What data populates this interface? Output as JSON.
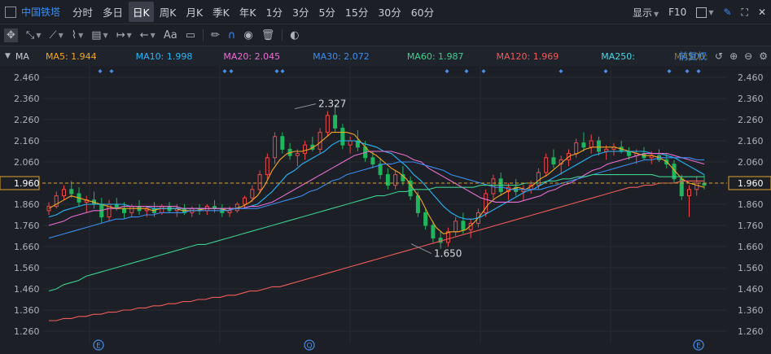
{
  "header": {
    "stock_name": "中国铁塔",
    "timeframes": [
      "分时",
      "多日",
      "日K",
      "周K",
      "月K",
      "季K",
      "年K",
      "1分",
      "3分",
      "5分",
      "15分",
      "30分",
      "60分"
    ],
    "active_timeframe": "日K",
    "display_label": "显示",
    "f10_label": "F10"
  },
  "toolbar": {
    "aa_label": "Aa",
    "icons": [
      "move-icon",
      "crosshair-icon",
      "line-tool-icon",
      "wave-tool-icon",
      "fib-tool-icon",
      "measure-tool-icon",
      "arrow-tool-icon",
      "text-tool-icon",
      "comment-icon",
      "pen-icon",
      "magnet-icon",
      "eye-icon",
      "trash-icon",
      "toggle-icon"
    ]
  },
  "ma_bar": {
    "label": "MA",
    "items": [
      {
        "label": "MA5: 1.944",
        "color": "#f5a623"
      },
      {
        "label": "MA10: 1.998",
        "color": "#29b6f6"
      },
      {
        "label": "MA20: 2.045",
        "color": "#e96fd4"
      },
      {
        "label": "MA30: 2.072",
        "color": "#3b8df0"
      },
      {
        "label": "MA60: 1.987",
        "color": "#3ccf8e"
      },
      {
        "label": "MA120: 1.969",
        "color": "#f05b5b"
      },
      {
        "label": "MA250:",
        "color": "#4ed6e6"
      },
      {
        "label": "MA500:",
        "color": "#8a7a3a"
      }
    ],
    "adjust_label": "前复权"
  },
  "chart_data": {
    "type": "candlestick",
    "ylim": [
      1.22,
      2.49
    ],
    "yticks": [
      "2.460",
      "2.360",
      "2.260",
      "2.160",
      "2.060",
      "1.960",
      "1.860",
      "1.760",
      "1.660",
      "1.560",
      "1.460",
      "1.360",
      "1.260"
    ],
    "current_price": "1.960",
    "annotations": [
      {
        "label": "2.327",
        "value": 2.327
      },
      {
        "label": "1.650",
        "value": 1.65
      }
    ],
    "event_markers": [
      "E",
      "Q",
      "E"
    ],
    "ohlc": [
      [
        1.83,
        1.87,
        1.81,
        1.85
      ],
      [
        1.85,
        1.92,
        1.84,
        1.9
      ],
      [
        1.9,
        1.95,
        1.88,
        1.93
      ],
      [
        1.93,
        1.97,
        1.89,
        1.91
      ],
      [
        1.91,
        1.94,
        1.85,
        1.87
      ],
      [
        1.87,
        1.9,
        1.82,
        1.88
      ],
      [
        1.88,
        1.92,
        1.84,
        1.86
      ],
      [
        1.86,
        1.89,
        1.77,
        1.8
      ],
      [
        1.8,
        1.88,
        1.78,
        1.86
      ],
      [
        1.86,
        1.89,
        1.83,
        1.84
      ],
      [
        1.84,
        1.87,
        1.79,
        1.82
      ],
      [
        1.82,
        1.86,
        1.8,
        1.85
      ],
      [
        1.85,
        1.88,
        1.81,
        1.83
      ],
      [
        1.83,
        1.85,
        1.8,
        1.84
      ],
      [
        1.84,
        1.87,
        1.8,
        1.82
      ],
      [
        1.82,
        1.86,
        1.81,
        1.85
      ],
      [
        1.85,
        1.87,
        1.82,
        1.83
      ],
      [
        1.83,
        1.86,
        1.8,
        1.84
      ],
      [
        1.84,
        1.86,
        1.81,
        1.82
      ],
      [
        1.82,
        1.85,
        1.8,
        1.84
      ],
      [
        1.84,
        1.86,
        1.81,
        1.83
      ],
      [
        1.83,
        1.86,
        1.81,
        1.85
      ],
      [
        1.85,
        1.88,
        1.82,
        1.84
      ],
      [
        1.84,
        1.86,
        1.8,
        1.82
      ],
      [
        1.82,
        1.85,
        1.8,
        1.83
      ],
      [
        1.83,
        1.87,
        1.82,
        1.86
      ],
      [
        1.86,
        1.9,
        1.84,
        1.89
      ],
      [
        1.89,
        1.95,
        1.87,
        1.93
      ],
      [
        1.93,
        2.02,
        1.91,
        2.0
      ],
      [
        2.0,
        2.1,
        1.98,
        2.08
      ],
      [
        2.08,
        2.2,
        2.05,
        2.18
      ],
      [
        2.18,
        2.2,
        2.1,
        2.12
      ],
      [
        2.12,
        2.15,
        2.07,
        2.09
      ],
      [
        2.09,
        2.12,
        2.04,
        2.1
      ],
      [
        2.1,
        2.16,
        2.07,
        2.14
      ],
      [
        2.14,
        2.18,
        2.11,
        2.12
      ],
      [
        2.12,
        2.22,
        2.1,
        2.2
      ],
      [
        2.2,
        2.3,
        2.18,
        2.28
      ],
      [
        2.28,
        2.33,
        2.2,
        2.22
      ],
      [
        2.22,
        2.24,
        2.12,
        2.14
      ],
      [
        2.14,
        2.18,
        2.1,
        2.16
      ],
      [
        2.16,
        2.21,
        2.11,
        2.13
      ],
      [
        2.13,
        2.16,
        2.06,
        2.08
      ],
      [
        2.08,
        2.11,
        2.03,
        2.05
      ],
      [
        2.05,
        2.08,
        1.98,
        2.0
      ],
      [
        2.0,
        2.03,
        1.93,
        1.95
      ],
      [
        1.95,
        2.02,
        1.93,
        2.0
      ],
      [
        2.0,
        2.04,
        1.95,
        1.97
      ],
      [
        1.97,
        1.99,
        1.88,
        1.9
      ],
      [
        1.9,
        1.92,
        1.8,
        1.82
      ],
      [
        1.82,
        1.84,
        1.74,
        1.76
      ],
      [
        1.76,
        1.78,
        1.68,
        1.7
      ],
      [
        1.7,
        1.73,
        1.65,
        1.68
      ],
      [
        1.68,
        1.75,
        1.66,
        1.73
      ],
      [
        1.73,
        1.8,
        1.71,
        1.78
      ],
      [
        1.78,
        1.82,
        1.72,
        1.74
      ],
      [
        1.74,
        1.79,
        1.7,
        1.77
      ],
      [
        1.77,
        1.84,
        1.75,
        1.82
      ],
      [
        1.82,
        1.93,
        1.8,
        1.91
      ],
      [
        1.91,
        2.0,
        1.88,
        1.98
      ],
      [
        1.98,
        2.01,
        1.9,
        1.92
      ],
      [
        1.92,
        1.96,
        1.88,
        1.94
      ],
      [
        1.94,
        1.98,
        1.9,
        1.92
      ],
      [
        1.92,
        1.95,
        1.88,
        1.93
      ],
      [
        1.93,
        1.97,
        1.91,
        1.95
      ],
      [
        1.95,
        2.03,
        1.93,
        2.01
      ],
      [
        2.01,
        2.1,
        1.99,
        2.08
      ],
      [
        2.08,
        2.12,
        2.03,
        2.05
      ],
      [
        2.05,
        2.09,
        2.0,
        2.07
      ],
      [
        2.07,
        2.12,
        2.04,
        2.1
      ],
      [
        2.1,
        2.17,
        2.08,
        2.15
      ],
      [
        2.15,
        2.2,
        2.11,
        2.13
      ],
      [
        2.13,
        2.19,
        2.1,
        2.16
      ],
      [
        2.16,
        2.18,
        2.09,
        2.11
      ],
      [
        2.11,
        2.14,
        2.07,
        2.12
      ],
      [
        2.12,
        2.15,
        2.09,
        2.13
      ],
      [
        2.13,
        2.16,
        2.1,
        2.11
      ],
      [
        2.11,
        2.13,
        2.07,
        2.09
      ],
      [
        2.09,
        2.12,
        2.05,
        2.1
      ],
      [
        2.1,
        2.13,
        2.07,
        2.08
      ],
      [
        2.08,
        2.11,
        2.05,
        2.09
      ],
      [
        2.09,
        2.12,
        2.06,
        2.07
      ],
      [
        2.07,
        2.1,
        2.03,
        2.05
      ],
      [
        2.05,
        2.07,
        1.96,
        1.98
      ],
      [
        1.98,
        2.0,
        1.88,
        1.9
      ],
      [
        1.9,
        1.95,
        1.8,
        1.93
      ],
      [
        1.93,
        1.99,
        1.9,
        1.96
      ],
      [
        1.96,
        2.0,
        1.93,
        1.95
      ]
    ],
    "ma": {
      "MA5": [
        1.84,
        1.86,
        1.88,
        1.9,
        1.89,
        1.88,
        1.87,
        1.86,
        1.85,
        1.84,
        1.84,
        1.84,
        1.84,
        1.84,
        1.83,
        1.84,
        1.84,
        1.84,
        1.83,
        1.83,
        1.83,
        1.84,
        1.84,
        1.84,
        1.83,
        1.84,
        1.85,
        1.87,
        1.9,
        1.95,
        2.02,
        2.07,
        2.1,
        2.11,
        2.11,
        2.12,
        2.14,
        2.17,
        2.2,
        2.2,
        2.2,
        2.19,
        2.15,
        2.11,
        2.09,
        2.06,
        2.03,
        2.01,
        1.98,
        1.93,
        1.88,
        1.81,
        1.75,
        1.72,
        1.73,
        1.73,
        1.74,
        1.77,
        1.81,
        1.86,
        1.89,
        1.91,
        1.93,
        1.94,
        1.93,
        1.95,
        1.98,
        2.0,
        2.03,
        2.06,
        2.09,
        2.1,
        2.12,
        2.13,
        2.13,
        2.13,
        2.13,
        2.12,
        2.11,
        2.1,
        2.09,
        2.09,
        2.08,
        2.06,
        2.02,
        1.98,
        1.96,
        1.95,
        1.94
      ],
      "MA10": [
        1.8,
        1.81,
        1.83,
        1.84,
        1.85,
        1.86,
        1.86,
        1.86,
        1.86,
        1.86,
        1.86,
        1.85,
        1.85,
        1.85,
        1.84,
        1.84,
        1.84,
        1.84,
        1.84,
        1.84,
        1.84,
        1.84,
        1.84,
        1.84,
        1.84,
        1.84,
        1.84,
        1.85,
        1.86,
        1.89,
        1.92,
        1.96,
        2.0,
        2.02,
        2.05,
        2.07,
        2.09,
        2.11,
        2.14,
        2.16,
        2.16,
        2.16,
        2.15,
        2.14,
        2.13,
        2.11,
        2.1,
        2.07,
        2.04,
        2.0,
        1.97,
        1.93,
        1.89,
        1.85,
        1.82,
        1.8,
        1.79,
        1.79,
        1.8,
        1.82,
        1.84,
        1.86,
        1.88,
        1.9,
        1.92,
        1.93,
        1.95,
        1.97,
        1.99,
        2.01,
        2.03,
        2.05,
        2.07,
        2.09,
        2.1,
        2.11,
        2.11,
        2.11,
        2.11,
        2.11,
        2.11,
        2.1,
        2.1,
        2.09,
        2.08,
        2.06,
        2.04,
        2.02,
        2.0
      ],
      "MA20": [
        1.76,
        1.77,
        1.78,
        1.8,
        1.81,
        1.82,
        1.83,
        1.83,
        1.84,
        1.84,
        1.85,
        1.85,
        1.85,
        1.85,
        1.85,
        1.85,
        1.85,
        1.85,
        1.84,
        1.84,
        1.84,
        1.84,
        1.84,
        1.84,
        1.84,
        1.84,
        1.84,
        1.85,
        1.85,
        1.86,
        1.87,
        1.89,
        1.91,
        1.93,
        1.95,
        1.97,
        1.99,
        2.01,
        2.03,
        2.05,
        2.07,
        2.09,
        2.1,
        2.11,
        2.11,
        2.11,
        2.11,
        2.1,
        2.09,
        2.07,
        2.06,
        2.03,
        2.01,
        1.99,
        1.97,
        1.95,
        1.93,
        1.91,
        1.89,
        1.88,
        1.87,
        1.87,
        1.87,
        1.87,
        1.88,
        1.89,
        1.9,
        1.92,
        1.93,
        1.95,
        1.96,
        1.98,
        2.0,
        2.02,
        2.03,
        2.05,
        2.06,
        2.07,
        2.08,
        2.09,
        2.1,
        2.1,
        2.1,
        2.1,
        2.09,
        2.08,
        2.07,
        2.06,
        2.05
      ],
      "MA30": [
        1.7,
        1.71,
        1.72,
        1.73,
        1.74,
        1.75,
        1.76,
        1.77,
        1.78,
        1.79,
        1.79,
        1.8,
        1.8,
        1.81,
        1.81,
        1.82,
        1.82,
        1.82,
        1.82,
        1.83,
        1.83,
        1.83,
        1.83,
        1.83,
        1.83,
        1.84,
        1.84,
        1.84,
        1.84,
        1.85,
        1.86,
        1.87,
        1.88,
        1.89,
        1.9,
        1.92,
        1.93,
        1.95,
        1.97,
        1.98,
        2.0,
        2.01,
        2.02,
        2.03,
        2.04,
        2.05,
        2.05,
        2.06,
        2.06,
        2.06,
        2.05,
        2.04,
        2.03,
        2.02,
        2.0,
        1.99,
        1.98,
        1.97,
        1.96,
        1.95,
        1.94,
        1.94,
        1.93,
        1.93,
        1.93,
        1.93,
        1.93,
        1.94,
        1.95,
        1.96,
        1.97,
        1.98,
        1.99,
        2.0,
        2.01,
        2.02,
        2.03,
        2.04,
        2.05,
        2.06,
        2.07,
        2.07,
        2.08,
        2.08,
        2.08,
        2.08,
        2.08,
        2.07,
        2.07
      ],
      "MA60": [
        1.45,
        1.46,
        1.48,
        1.49,
        1.5,
        1.52,
        1.53,
        1.54,
        1.55,
        1.56,
        1.57,
        1.58,
        1.59,
        1.6,
        1.61,
        1.62,
        1.63,
        1.64,
        1.65,
        1.66,
        1.67,
        1.67,
        1.68,
        1.69,
        1.7,
        1.71,
        1.72,
        1.73,
        1.74,
        1.75,
        1.76,
        1.77,
        1.78,
        1.79,
        1.8,
        1.81,
        1.82,
        1.83,
        1.84,
        1.85,
        1.86,
        1.87,
        1.88,
        1.89,
        1.9,
        1.9,
        1.91,
        1.92,
        1.92,
        1.93,
        1.93,
        1.93,
        1.94,
        1.94,
        1.94,
        1.94,
        1.94,
        1.94,
        1.95,
        1.95,
        1.95,
        1.95,
        1.95,
        1.95,
        1.96,
        1.96,
        1.96,
        1.97,
        1.97,
        1.98,
        1.98,
        1.99,
        1.99,
        2.0,
        2.0,
        2.0,
        2.0,
        2.0,
        2.0,
        2.0,
        2.0,
        2.0,
        1.99,
        1.99,
        1.99,
        1.99,
        1.99,
        1.99,
        1.99
      ],
      "MA120": [
        1.31,
        1.31,
        1.32,
        1.32,
        1.33,
        1.33,
        1.34,
        1.34,
        1.35,
        1.35,
        1.36,
        1.36,
        1.37,
        1.37,
        1.38,
        1.38,
        1.39,
        1.39,
        1.4,
        1.4,
        1.41,
        1.41,
        1.42,
        1.42,
        1.43,
        1.43,
        1.44,
        1.45,
        1.45,
        1.46,
        1.47,
        1.47,
        1.48,
        1.49,
        1.5,
        1.51,
        1.52,
        1.53,
        1.54,
        1.55,
        1.56,
        1.57,
        1.58,
        1.59,
        1.6,
        1.61,
        1.62,
        1.63,
        1.64,
        1.65,
        1.66,
        1.67,
        1.68,
        1.69,
        1.7,
        1.71,
        1.72,
        1.73,
        1.74,
        1.75,
        1.76,
        1.77,
        1.78,
        1.79,
        1.8,
        1.81,
        1.82,
        1.83,
        1.84,
        1.85,
        1.86,
        1.87,
        1.88,
        1.89,
        1.9,
        1.91,
        1.92,
        1.93,
        1.94,
        1.94,
        1.95,
        1.95,
        1.96,
        1.96,
        1.96,
        1.97,
        1.97,
        1.97,
        1.97
      ]
    }
  }
}
